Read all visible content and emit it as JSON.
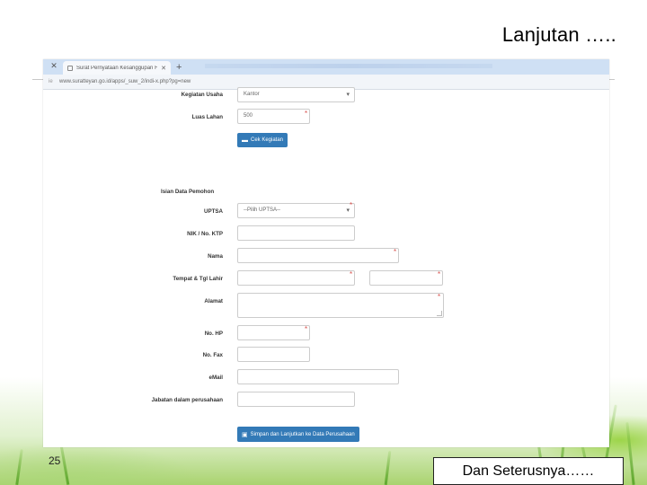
{
  "slide": {
    "title": "Lanjutan …..",
    "page_number": "25",
    "next_label": "Dan Seterusnya……"
  },
  "browser": {
    "prev_tab_close": "✕",
    "tab_title": "Surat Pernyataan Kesanggupan F",
    "tab_close": "✕",
    "new_tab": "+",
    "address_left": "ie",
    "url": "www.suratteyan.go.id/apps/_suw_2/indi-x.php?pg=new"
  },
  "form": {
    "kegiatan_usaha": {
      "label": "Kegiatan Usaha",
      "value": "Kantor"
    },
    "luas_lahan": {
      "label": "Luas Lahan",
      "value": "500"
    },
    "cek_button": "Cek Kegiatan",
    "section_title": "Isian Data Pemohon",
    "uptsa": {
      "label": "UPTSA",
      "value": "--Pilih UPTSA--"
    },
    "nik": {
      "label": "NIK / No. KTP"
    },
    "nama": {
      "label": "Nama"
    },
    "ttl": {
      "label": "Tempat & Tgl Lahir"
    },
    "alamat": {
      "label": "Alamat"
    },
    "hp": {
      "label": "No. HP"
    },
    "fax": {
      "label": "No. Fax"
    },
    "email": {
      "label": "eMail"
    },
    "jabatan": {
      "label": "Jabatan dalam perusahaan"
    },
    "submit_button": "Simpan dan Lanjutkan ke Data Perusahaan",
    "required_mark": "*"
  },
  "colors": {
    "button": "#337ab7",
    "required": "#d9534f",
    "tabbar": "#cfe0f4",
    "grass": "#a9d36f"
  }
}
